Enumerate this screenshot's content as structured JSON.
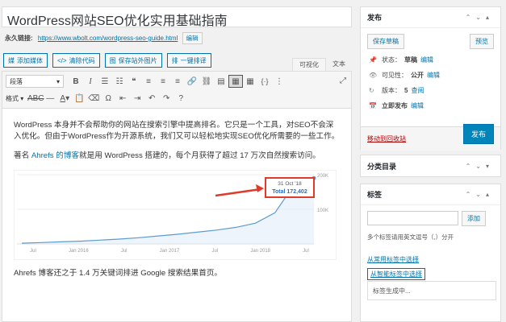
{
  "post": {
    "title": "WordPress网站SEO优化实用基础指南",
    "permalink_label": "永久链接:",
    "permalink_url": "https://www.wbolt.com/wordpress-seo-guide.html",
    "permalink_edit": "编辑"
  },
  "media_buttons": [
    {
      "icon": "媒",
      "label": "添加媒体"
    },
    {
      "icon": "</>",
      "label": "清除代码"
    },
    {
      "icon": "图",
      "label": "保存站外图片"
    },
    {
      "icon": "排",
      "label": "一键排译"
    }
  ],
  "editor_tabs": {
    "visual": "可视化",
    "text": "文本"
  },
  "toolbar": {
    "format_select": "段落",
    "format_menu": "格式"
  },
  "content": {
    "para1": "WordPress 本身并不会帮助你的网站在搜索引擎中提高排名。它只是一个工具，对SEO不会深入优化。但由于WordPress作为开源系统，我们又可以轻松地实现SEO优化所需要的一些工作。",
    "para2_pre": "著名 ",
    "para2_link": "Ahrefs 的博客",
    "para2_post": "就是用 WordPress 搭建的，每个月获得了超过 17 万次自然搜索访问。",
    "para3": "Ahrefs 博客还之于 1.4 万关键词排进 Google 搜索结果首页。"
  },
  "chart_data": {
    "type": "area",
    "x_ticks": [
      "Jul",
      "Jan 2016",
      "Jul",
      "Jan 2017",
      "Jul",
      "Jan 2018",
      "Jul"
    ],
    "y_ticks": [
      "200K",
      "100K"
    ],
    "annotation_date": "31 Oct '18",
    "annotation_total": "Total 172,402",
    "ylim": [
      0,
      200000
    ],
    "series": [
      {
        "values": [
          2000,
          4000,
          6000,
          8000,
          11000,
          14000,
          18000,
          23000,
          28000,
          34000,
          40000,
          48000,
          60000,
          90000,
          172402,
          190000
        ]
      }
    ],
    "colors": {
      "line": "#5b9bd5",
      "annotation": "#e03a2b"
    }
  },
  "sidebar": {
    "publish": {
      "title": "发布",
      "save_draft": "保存草稿",
      "preview": "预览",
      "status_label": "状态：",
      "status_value": "草稿",
      "visibility_label": "可见性：",
      "visibility_value": "公开",
      "revisions_label": "版本：",
      "revisions_value": "5",
      "revisions_link": "查阅",
      "schedule_label": "立即发布",
      "edit": "编辑",
      "trash": "移动到回收站",
      "publish_btn": "发布"
    },
    "categories": {
      "title": "分类目录"
    },
    "tags": {
      "title": "标签",
      "add_btn": "添加",
      "hint": "多个标签请用英文逗号（,）分开",
      "common_link": "从常用标签中选择",
      "smart_link": "从智能标签中选择",
      "generating": "标签生成中..."
    }
  }
}
